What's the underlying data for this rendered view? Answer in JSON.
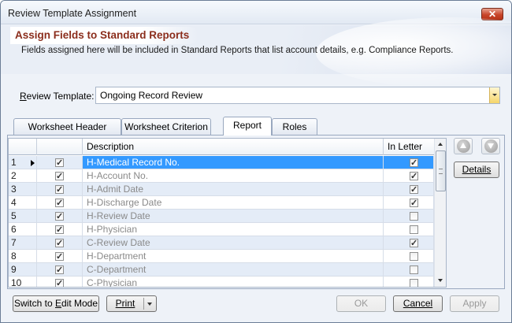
{
  "window": {
    "title": "Review Template Assignment",
    "close_label": "✕"
  },
  "banner": {
    "title": "Assign Fields to Standard Reports",
    "description": "Fields assigned here will be included in Standard Reports that list account details, e.g. Compliance Reports."
  },
  "review_template": {
    "label_first": "R",
    "label_rest": "eview Template:",
    "value": "Ongoing Record Review"
  },
  "tabs": [
    {
      "label": "Worksheet Header",
      "underline_char": "H",
      "active": false
    },
    {
      "label": "Worksheet Criterion",
      "underline_char": "C",
      "active": false
    },
    {
      "label": "Report",
      "underline_char": "R",
      "active": true
    },
    {
      "label": "Roles",
      "underline_char": "o",
      "active": false
    }
  ],
  "grid": {
    "columns": {
      "description": "Description",
      "in_letter": "In Letter"
    },
    "selected_row": 1,
    "rows": [
      {
        "num": "1",
        "included": true,
        "description": "H-Medical Record No.",
        "in_letter": true
      },
      {
        "num": "2",
        "included": true,
        "description": "H-Account No.",
        "in_letter": true
      },
      {
        "num": "3",
        "included": true,
        "description": "H-Admit Date",
        "in_letter": true
      },
      {
        "num": "4",
        "included": true,
        "description": "H-Discharge Date",
        "in_letter": true
      },
      {
        "num": "5",
        "included": true,
        "description": "H-Review Date",
        "in_letter": false
      },
      {
        "num": "6",
        "included": true,
        "description": "H-Physician",
        "in_letter": false
      },
      {
        "num": "7",
        "included": true,
        "description": "C-Review Date",
        "in_letter": true
      },
      {
        "num": "8",
        "included": true,
        "description": "H-Department",
        "in_letter": false
      },
      {
        "num": "9",
        "included": true,
        "description": "C-Department",
        "in_letter": false
      },
      {
        "num": "10",
        "included": true,
        "description": "C-Physician",
        "in_letter": false
      }
    ]
  },
  "side": {
    "details_label": "Details"
  },
  "footer": {
    "switch_label_pre": "Switch to ",
    "switch_label_u": "E",
    "switch_label_post": "dit Mode",
    "print_label": "Print",
    "ok_label": "OK",
    "cancel_label": "Cancel",
    "apply_label": "Apply"
  },
  "colors": {
    "selection": "#3399ff",
    "banner_title": "#8b2d1c",
    "alt_row": "#e4ecf7"
  }
}
